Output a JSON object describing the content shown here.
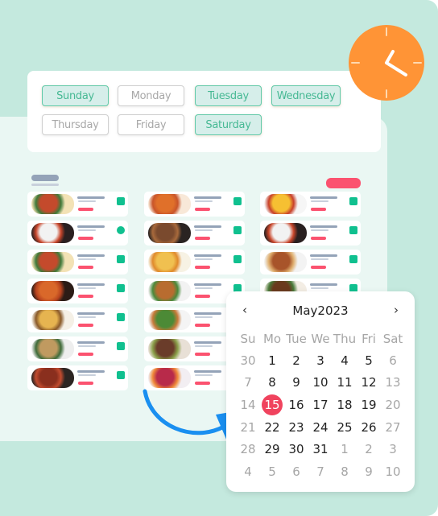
{
  "colors": {
    "background_outer": "#c4e9de",
    "background_inner": "#eaf7f3",
    "accent_green": "#47b994",
    "status_green": "#10c08f",
    "accent_red": "#fb526f",
    "selected_date": "#f0435e",
    "clock_orange": "#ff9436",
    "arrow_blue": "#1a8ff0"
  },
  "days": [
    {
      "label": "Sunday",
      "selected": true
    },
    {
      "label": "Monday",
      "selected": false
    },
    {
      "label": "Tuesday",
      "selected": true
    },
    {
      "label": "Wednesday",
      "selected": true
    },
    {
      "label": "Thursday",
      "selected": false
    },
    {
      "label": "Friday",
      "selected": false
    },
    {
      "label": "Saturday",
      "selected": true
    }
  ],
  "icons": {
    "clock": "clock-icon",
    "arrow": "curved-arrow-icon",
    "prev": "chevron-left-icon",
    "next": "chevron-right-icon"
  },
  "meal_columns": [
    {
      "items": [
        {
          "food": "flatbread-pizza",
          "status": "square"
        },
        {
          "food": "skillet-egg-dish",
          "status": "round"
        },
        {
          "food": "flatbread-pizza",
          "status": "square"
        },
        {
          "food": "curry-stew",
          "status": "square"
        },
        {
          "food": "loaded-fries",
          "status": "square"
        },
        {
          "food": "grain-salad-bowl",
          "status": "square"
        },
        {
          "food": "braised-chicken",
          "status": "square"
        }
      ]
    },
    {
      "items": [
        {
          "food": "fried-rice",
          "status": "square"
        },
        {
          "food": "grilled-steak",
          "status": "square"
        },
        {
          "food": "mac-and-cheese",
          "status": "square"
        },
        {
          "food": "veggie-bowl",
          "status": "square"
        },
        {
          "food": "roast-chicken-salad",
          "status": "square"
        },
        {
          "food": "beef-stir-fry",
          "status": "square"
        },
        {
          "food": "fruit-bowl",
          "status": "square"
        }
      ]
    },
    {
      "items": [
        {
          "food": "fried-eggs-toast",
          "status": "square"
        },
        {
          "food": "skillet-egg-dish",
          "status": "square"
        },
        {
          "food": "english-breakfast",
          "status": "square"
        },
        {
          "food": "roast-meat",
          "status": "square"
        }
      ]
    }
  ],
  "calendar": {
    "prev_label": "‹",
    "next_label": "›",
    "title": "May2023",
    "weekdays": [
      "Su",
      "Mo",
      "Tue",
      "We",
      "Thu",
      "Fri",
      "Sat"
    ],
    "selected": 15,
    "weeks": [
      [
        {
          "d": "30",
          "m": true
        },
        {
          "d": "1"
        },
        {
          "d": "2"
        },
        {
          "d": "3"
        },
        {
          "d": "4"
        },
        {
          "d": "5"
        },
        {
          "d": "6",
          "m": true
        }
      ],
      [
        {
          "d": "7",
          "m": true
        },
        {
          "d": "8"
        },
        {
          "d": "9"
        },
        {
          "d": "10"
        },
        {
          "d": "11"
        },
        {
          "d": "12"
        },
        {
          "d": "13",
          "m": true
        }
      ],
      [
        {
          "d": "14",
          "m": true
        },
        {
          "d": "15",
          "s": true
        },
        {
          "d": "16"
        },
        {
          "d": "17"
        },
        {
          "d": "18"
        },
        {
          "d": "19"
        },
        {
          "d": "20",
          "m": true
        }
      ],
      [
        {
          "d": "21",
          "m": true
        },
        {
          "d": "22"
        },
        {
          "d": "23"
        },
        {
          "d": "24"
        },
        {
          "d": "25"
        },
        {
          "d": "26"
        },
        {
          "d": "27",
          "m": true
        }
      ],
      [
        {
          "d": "28",
          "m": true
        },
        {
          "d": "29"
        },
        {
          "d": "30"
        },
        {
          "d": "31"
        },
        {
          "d": "1",
          "m": true
        },
        {
          "d": "2",
          "m": true
        },
        {
          "d": "3",
          "m": true
        }
      ],
      [
        {
          "d": "4",
          "m": true
        },
        {
          "d": "5",
          "m": true
        },
        {
          "d": "6",
          "m": true
        },
        {
          "d": "7",
          "m": true
        },
        {
          "d": "8",
          "m": true
        },
        {
          "d": "9",
          "m": true
        },
        {
          "d": "10",
          "m": true
        }
      ]
    ]
  }
}
